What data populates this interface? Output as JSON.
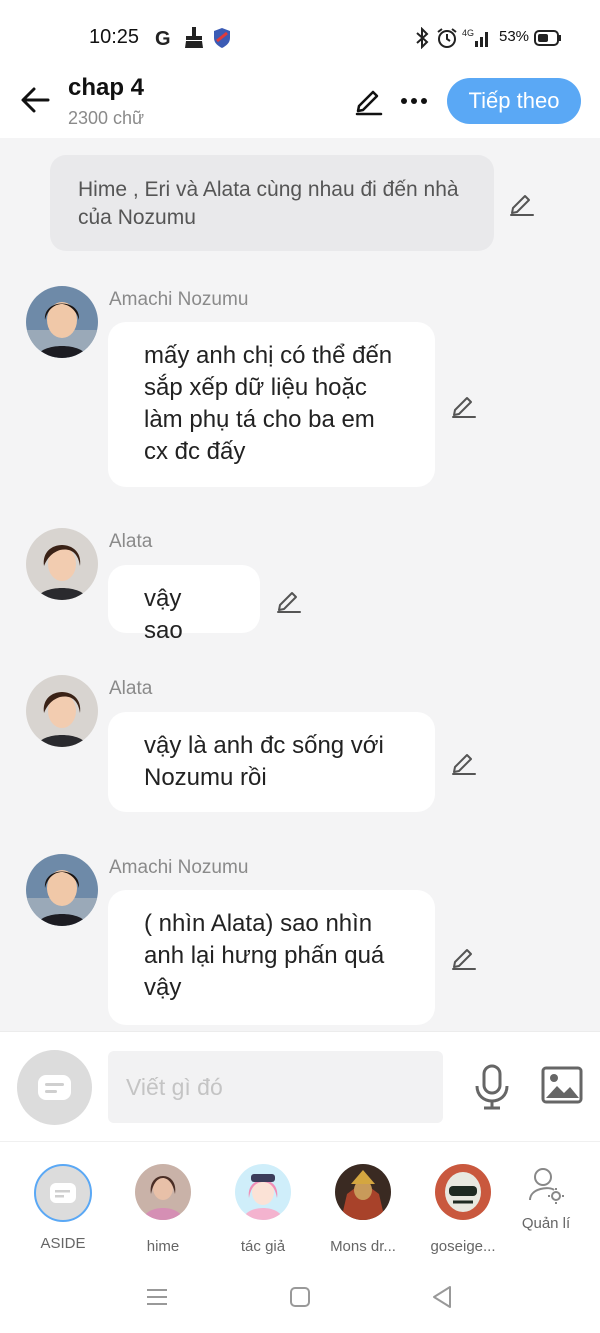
{
  "status_bar": {
    "time": "10:25",
    "battery": "53%",
    "icons": [
      "google-icon",
      "broom-icon",
      "shield-app-icon",
      "bluetooth-icon",
      "alarm-icon",
      "4g-signal-icon",
      "battery-icon"
    ]
  },
  "header": {
    "title": "chap 4",
    "word_count": "2300 chữ",
    "next_button": "Tiếp theo",
    "accent_color": "#5aa8f5"
  },
  "chat": {
    "narration": "Hime , Eri và Alata cùng nhau đi đến nhà của Nozumu",
    "messages": [
      {
        "speaker": "Amachi Nozumu",
        "text": "mấy anh chị có thể đến sắp xếp dữ liệu hoặc làm phụ tá cho ba em cx đc đấy"
      },
      {
        "speaker": "Alata",
        "text": "vậy sao"
      },
      {
        "speaker": "Alata",
        "text": "vậy là anh đc sống với Nozumu rồi"
      },
      {
        "speaker": "Amachi Nozumu",
        "text": "( nhìn Alata) sao nhìn anh lại hưng phấn quá vậy"
      }
    ]
  },
  "input": {
    "placeholder": "Viết gì đó"
  },
  "characters": [
    {
      "label": "ASIDE"
    },
    {
      "label": "hime"
    },
    {
      "label": "tác giả"
    },
    {
      "label": "Mons dr..."
    },
    {
      "label": "goseige..."
    },
    {
      "label": "Quản lí"
    }
  ]
}
